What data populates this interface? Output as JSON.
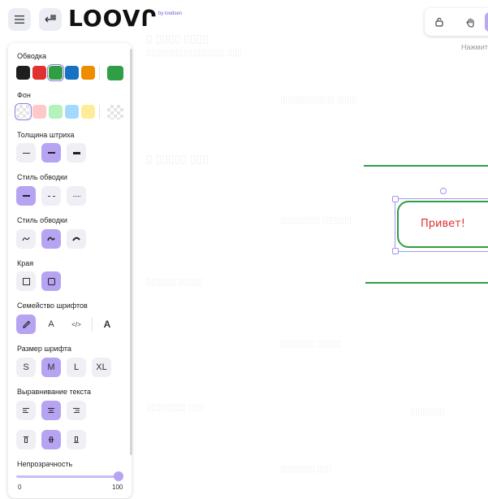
{
  "app": {
    "logo_text": "LOOVՐ",
    "logo_by": "by loodsen"
  },
  "toolbar": {
    "hint_text": "Нажмит",
    "tools": [
      "lock-icon",
      "hand-icon",
      "selection-icon"
    ]
  },
  "panel": {
    "stroke_label": "Обводка",
    "stroke_colors": [
      "#1e1e1e",
      "#e03131",
      "#2f9e44",
      "#1971c2",
      "#f08c00"
    ],
    "stroke_current": "#2f9e44",
    "background_label": "Фон",
    "background_colors": [
      "transparent",
      "#ffc9c9",
      "#b2f2bb",
      "#a5d8ff",
      "#ffec99"
    ],
    "stroke_width_label": "Толщина штриха",
    "stroke_style_label": "Стиль обводки",
    "sloppiness_label": "Стиль обводки",
    "edges_label": "Края",
    "font_family_label": "Семейство шрифтов",
    "font_size_label": "Размер шрифта",
    "font_sizes": [
      "S",
      "M",
      "L",
      "XL"
    ],
    "font_size_selected": "M",
    "text_align_label": "Выравнивание текста",
    "opacity_label": "Непрозрачность",
    "opacity_min": "0",
    "opacity_max": "100",
    "opacity_value": 100
  },
  "canvas": {
    "shape_text": "Привет!",
    "shape_color": "#2f9e44",
    "text_color": "#e03131"
  }
}
